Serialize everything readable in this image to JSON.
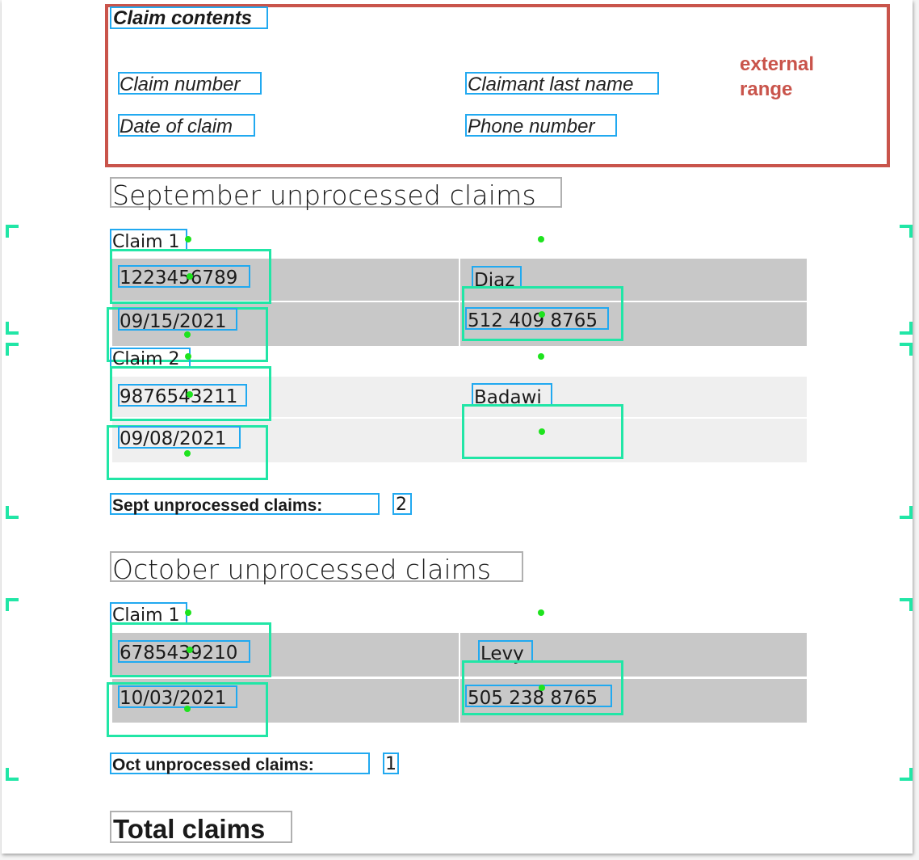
{
  "header": {
    "title": "Claim contents",
    "fields": {
      "claim_number": "Claim number",
      "claimant_last_name": "Claimant last name",
      "date_of_claim": "Date of claim",
      "phone_number": "Phone number"
    },
    "external_label": "external\nrange"
  },
  "september": {
    "heading": "September unprocessed claims",
    "claims": [
      {
        "label": "Claim 1",
        "number": "1223456789",
        "last_name": "Diaz",
        "date": "09/15/2021",
        "phone": "512 409 8765"
      },
      {
        "label": "Claim 2",
        "number": "9876543211",
        "last_name": "Badawi",
        "date": "09/08/2021",
        "phone": ""
      }
    ],
    "count_label": "Sept unprocessed claims:",
    "count_value": "2"
  },
  "october": {
    "heading": "October unprocessed claims",
    "claims": [
      {
        "label": "Claim 1",
        "number": "6785439210",
        "last_name": "Levy",
        "date": "10/03/2021",
        "phone": "505 238 8765"
      }
    ],
    "count_label": "Oct unprocessed claims:",
    "count_value": "1"
  },
  "total": {
    "heading": "Total claims"
  },
  "colors": {
    "red_frame": "#c9544b",
    "blue_box": "#21a9f0",
    "green_box": "#21e6a6",
    "dot": "#1ee31e",
    "row_dark": "#c8c8c8",
    "row_light": "#efefef"
  }
}
